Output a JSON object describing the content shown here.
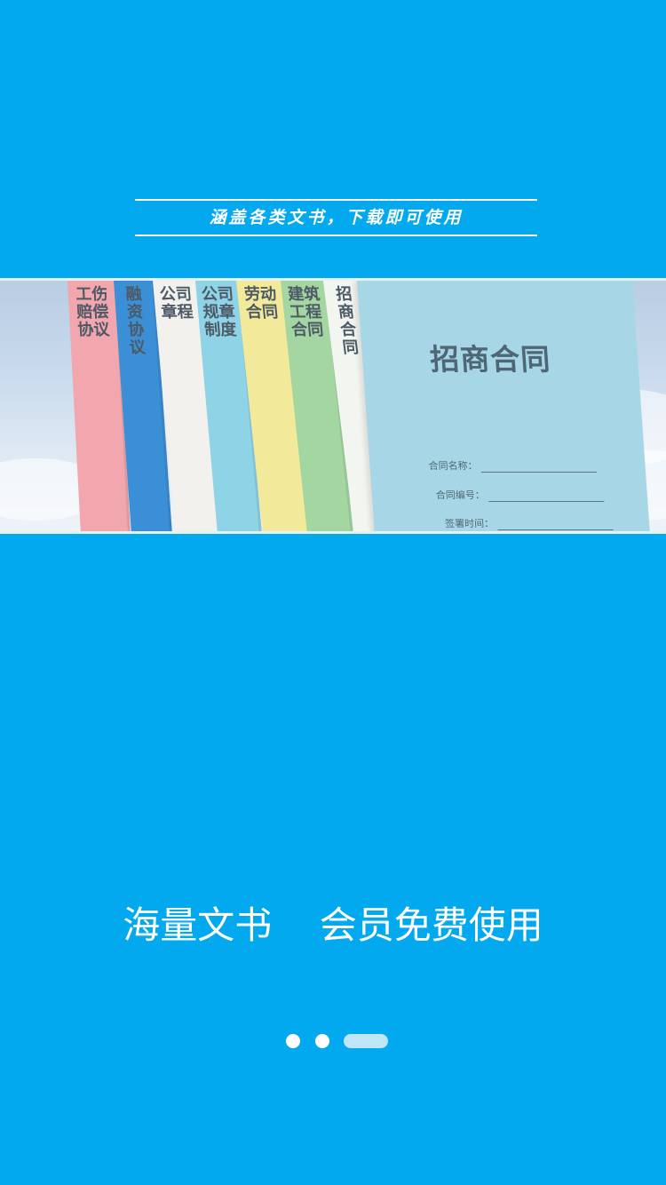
{
  "splash": {
    "tagline": "涵盖各类文书，下载即可使用",
    "headline": "海量文书    会员免费使用",
    "pager": {
      "total": 3,
      "active_index": 2
    }
  },
  "banner": {
    "books": [
      {
        "title": "工伤赔偿协议",
        "color": "#f1a7ad"
      },
      {
        "title": "融资协议",
        "color": "#3b8fd6"
      },
      {
        "title": "公司章程",
        "color": "#f3f1ee"
      },
      {
        "title": "公司规章制度",
        "color": "#8fd3e6"
      },
      {
        "title": "劳动合同",
        "color": "#f2ea9a"
      },
      {
        "title": "建筑工程合同",
        "color": "#a4d6a2"
      },
      {
        "title": "招商合同",
        "color": "#f3f5f1"
      }
    ],
    "cover": {
      "title": "招商合同",
      "fields": [
        {
          "label": "合同名称："
        },
        {
          "label": "合同编号："
        },
        {
          "label": "签署时间："
        }
      ]
    }
  },
  "colors": {
    "background": "#03a9ee",
    "text": "#ffffff",
    "pager_active": "#bfe6f8"
  }
}
